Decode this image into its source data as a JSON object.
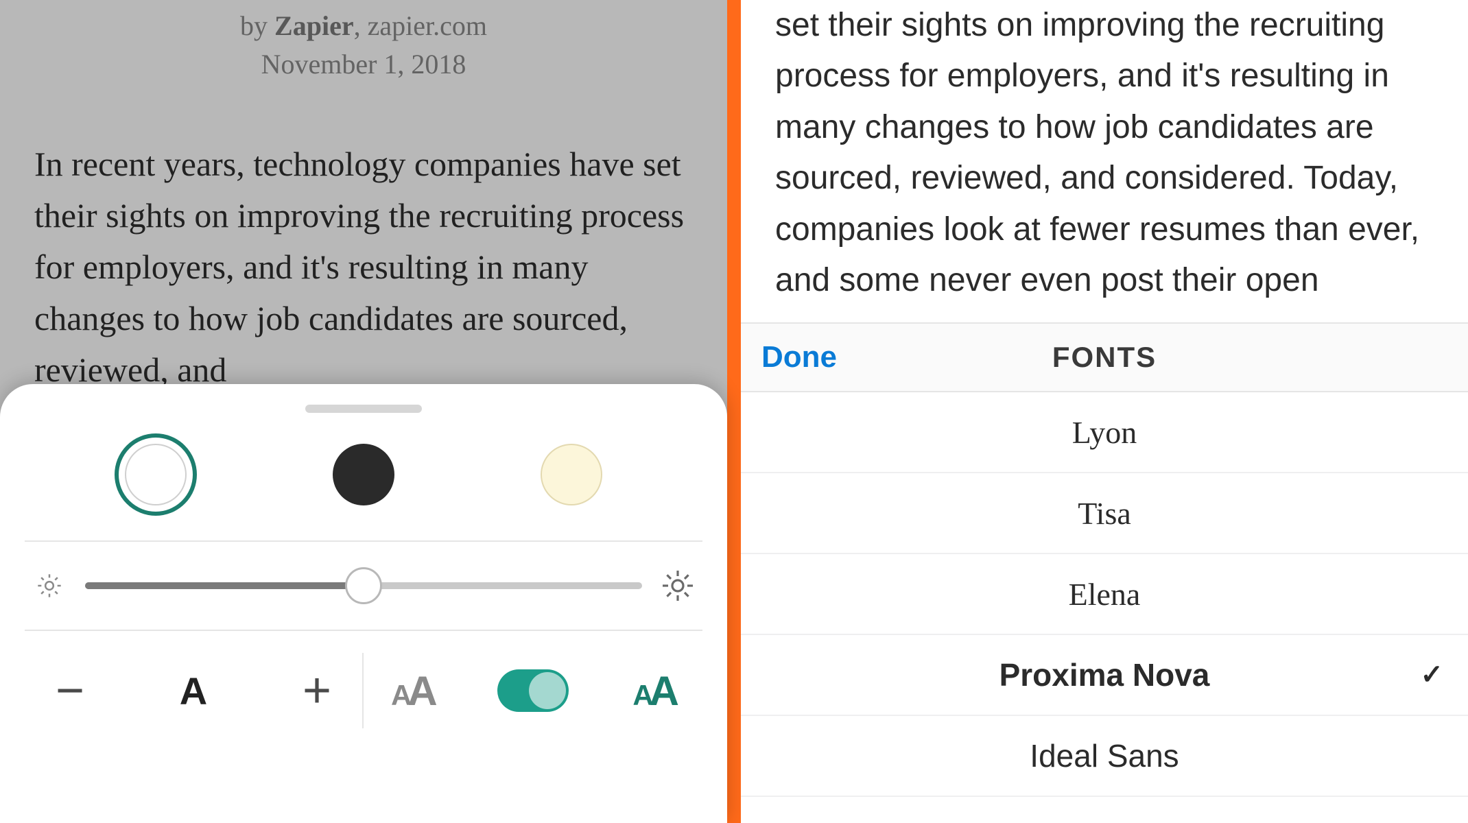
{
  "left": {
    "byline_prefix": "by ",
    "author": "Zapier",
    "source": ", zapier.com",
    "date": "November 1, 2018",
    "body": "In recent years, technology companies have set their sights on improving the recruiting process for employers, and it's resulting in many changes to how job candidates are sourced, reviewed, and",
    "sheet": {
      "themes": [
        "light",
        "dark",
        "sepia"
      ],
      "selected_theme": "light",
      "brightness": 0.5,
      "font_size_label": "A",
      "decrease_label": "−",
      "increase_label": "+",
      "auto_toggle": true
    }
  },
  "right": {
    "body": "set their sights on improving the recruiting process for employers, and it's resulting in many changes to how job candidates are sourced, reviewed, and considered. Today, companies look at fewer resumes than ever, and some never even post their open",
    "done_label": "Done",
    "fonts_title": "FONTS",
    "fonts": [
      {
        "name": "Lyon",
        "selected": false,
        "sans": false
      },
      {
        "name": "Tisa",
        "selected": false,
        "sans": false
      },
      {
        "name": "Elena",
        "selected": false,
        "sans": false
      },
      {
        "name": "Proxima Nova",
        "selected": true,
        "sans": true
      },
      {
        "name": "Ideal Sans",
        "selected": false,
        "sans": true
      }
    ]
  },
  "colors": {
    "accent": "#ff6a1a",
    "teal": "#1c7e6e",
    "blue": "#0a7bd6"
  }
}
